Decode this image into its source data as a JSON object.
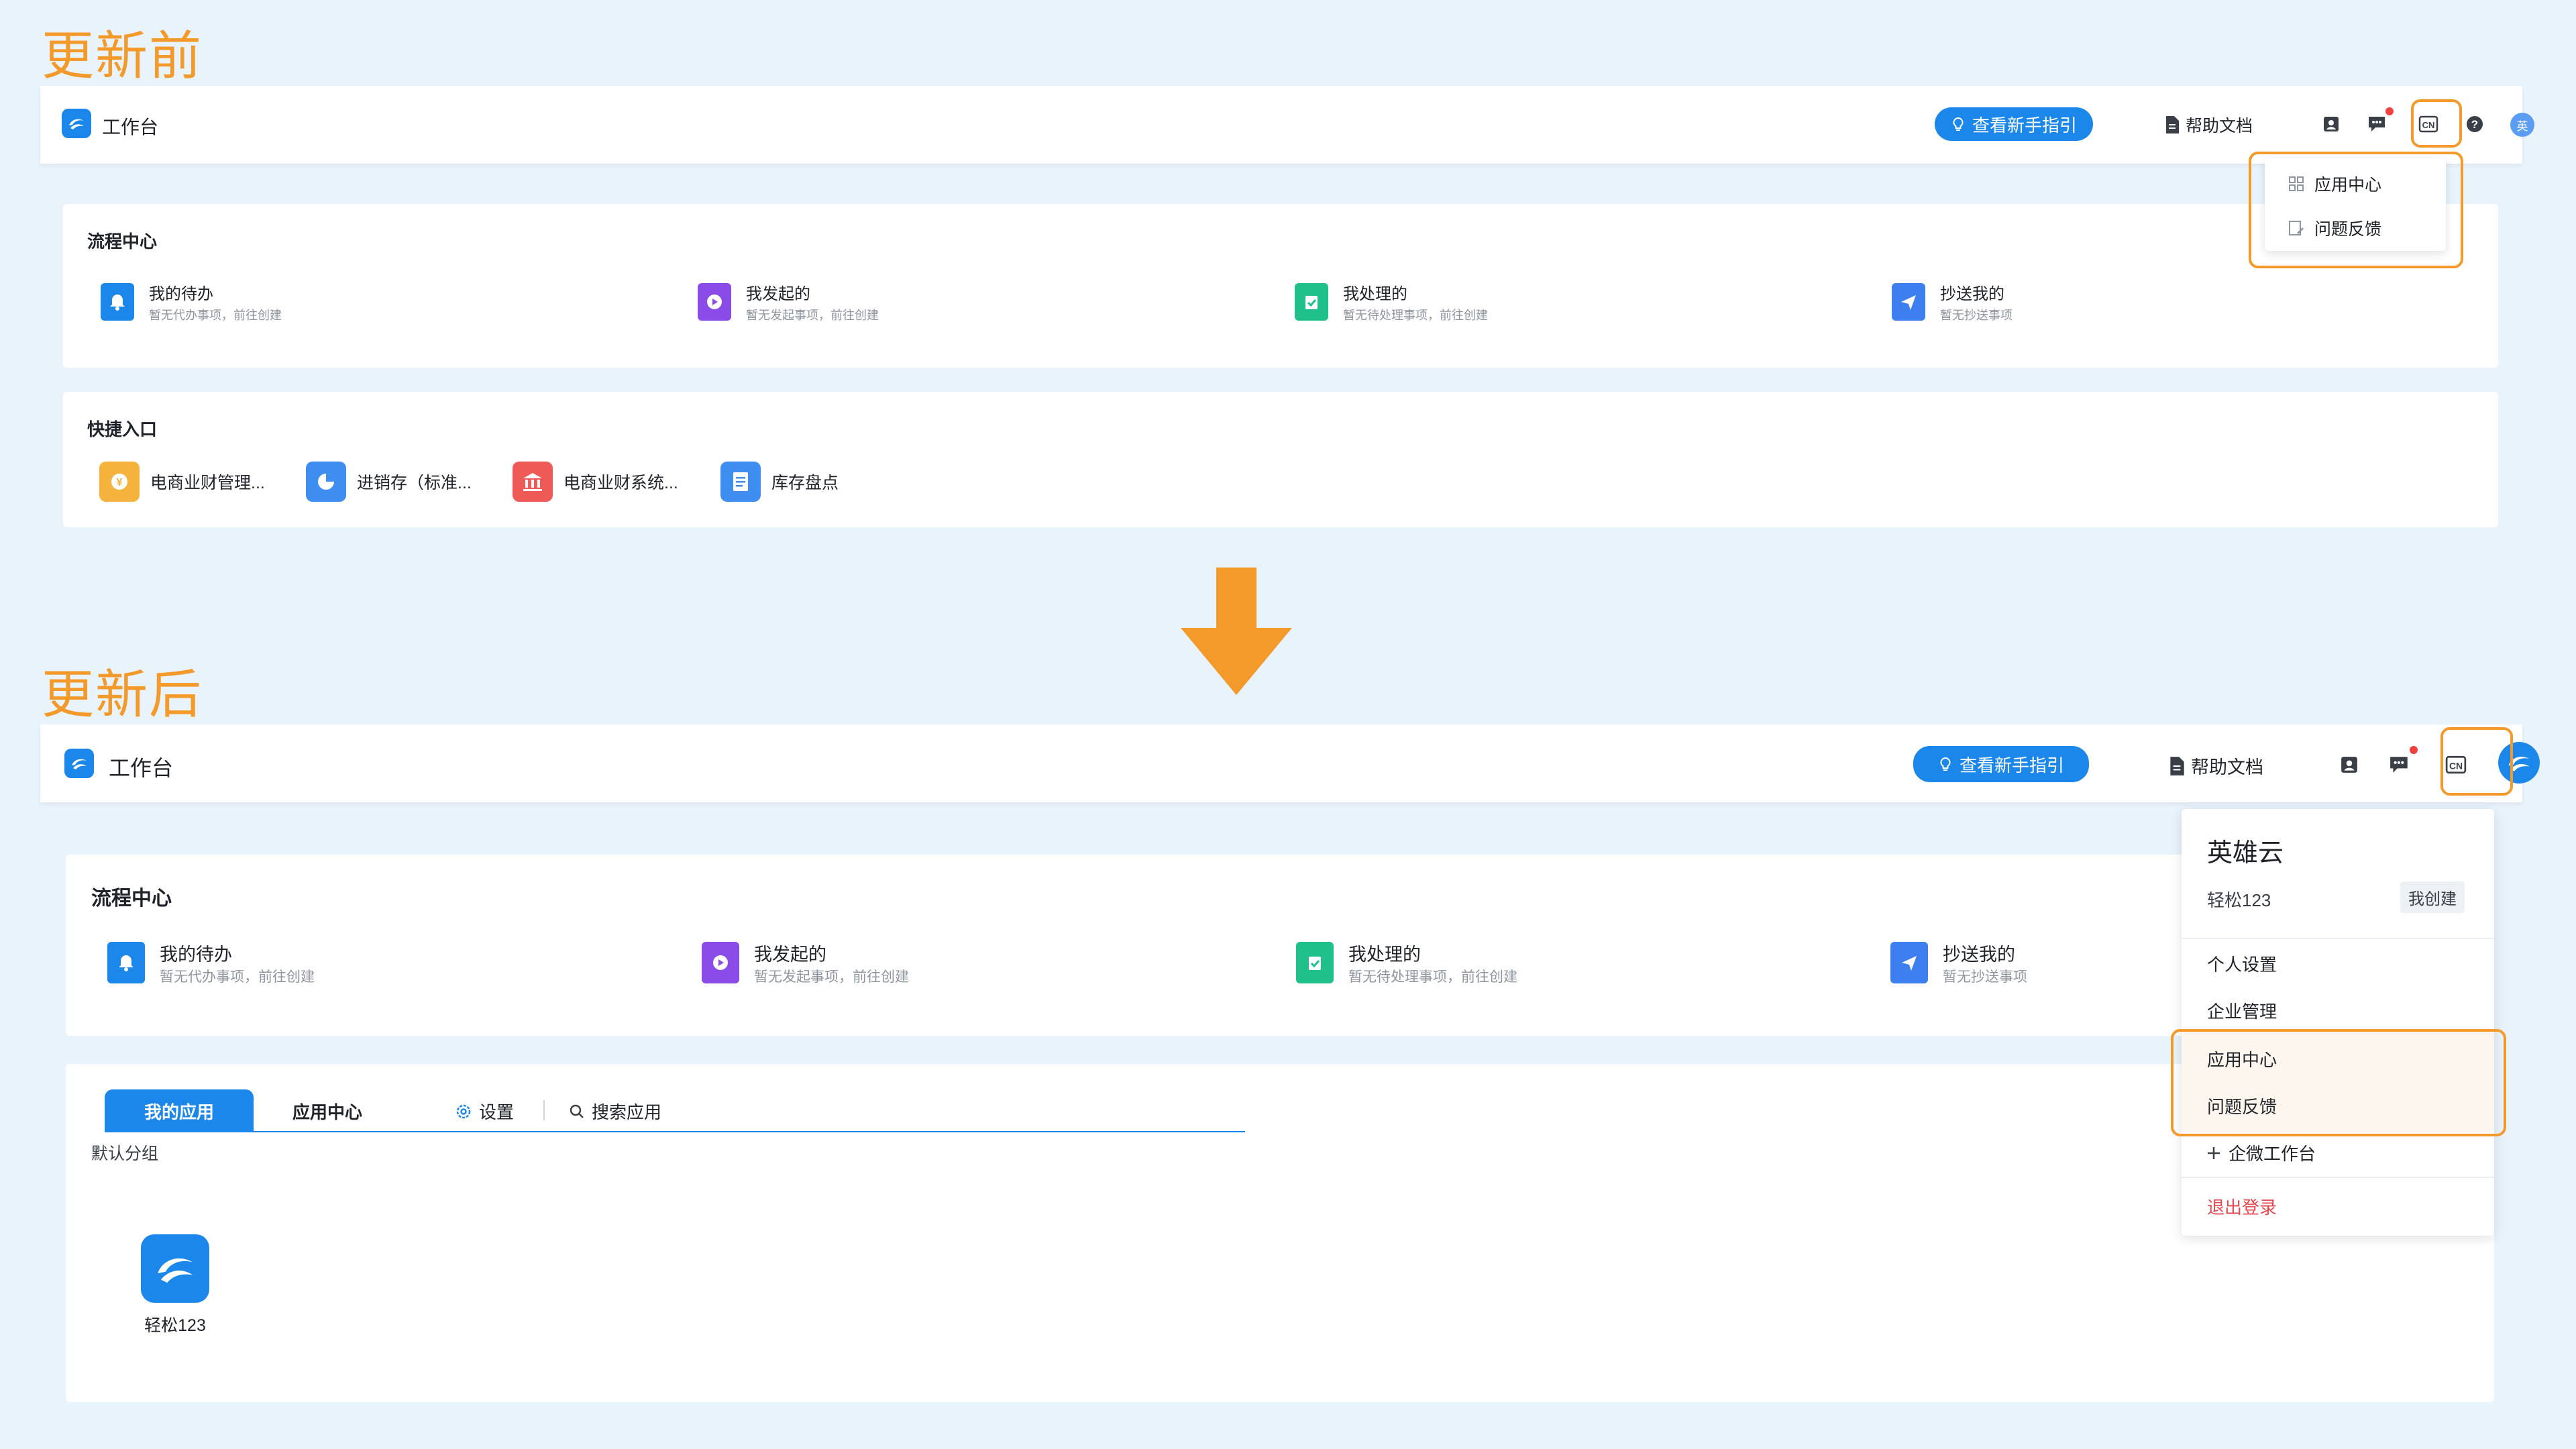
{
  "before": {
    "caption": "更新前",
    "header": {
      "title": "工作台",
      "guide_button": "查看新手指引",
      "help_docs": "帮助文档",
      "avatar_char": "英"
    },
    "dropdown": {
      "items": [
        "应用中心",
        "问题反馈"
      ]
    },
    "flow": {
      "title": "流程中心",
      "items": [
        {
          "name": "我的待办",
          "sub": "暂无代办事项，前往创建"
        },
        {
          "name": "我发起的",
          "sub": "暂无发起事项，前往创建"
        },
        {
          "name": "我处理的",
          "sub": "暂无待处理事项，前往创建"
        },
        {
          "name": "抄送我的",
          "sub": "暂无抄送事项"
        }
      ]
    },
    "quick": {
      "title": "快捷入口",
      "items": [
        "电商业财管理...",
        "进销存（标准...",
        "电商业财系统...",
        "库存盘点"
      ]
    }
  },
  "after": {
    "caption": "更新后",
    "header": {
      "title": "工作台",
      "guide_button": "查看新手指引",
      "help_docs": "帮助文档"
    },
    "flow": {
      "title": "流程中心",
      "items": [
        {
          "name": "我的待办",
          "sub": "暂无代办事项，前往创建"
        },
        {
          "name": "我发起的",
          "sub": "暂无发起事项，前往创建"
        },
        {
          "name": "我处理的",
          "sub": "暂无待处理事项，前往创建"
        },
        {
          "name": "抄送我的",
          "sub": "暂无抄送事项"
        }
      ]
    },
    "apps": {
      "tabs": [
        "我的应用",
        "应用中心"
      ],
      "settings": "设置",
      "search": "搜索应用",
      "group": "默认分组",
      "app_name": "轻松123"
    },
    "menu": {
      "company": "英雄云",
      "app": "轻松123",
      "badge": "我创建",
      "personal": "个人设置",
      "enterprise": "企业管理",
      "app_center": "应用中心",
      "feedback": "问题反馈",
      "wechat": "企微工作台",
      "logout": "退出登录"
    }
  },
  "colors": {
    "accent": "#1b87ea",
    "highlight": "#f39a2b",
    "background": "#e9f3fc",
    "logout": "#e5484d"
  }
}
